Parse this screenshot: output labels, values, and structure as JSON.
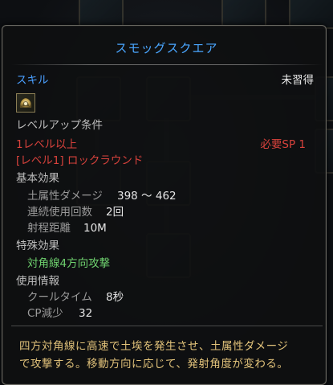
{
  "tooltip": {
    "title": "スモッグスクエア",
    "category_label": "スキル",
    "status": "未習得",
    "levelup_header": "レベルアップ条件",
    "req_level": "1レベル以上",
    "req_sp": "必要SP 1",
    "req_skill": "[レベル1] ロックラウンド",
    "basic_header": "基本効果",
    "basic": [
      {
        "label": "土属性ダメージ",
        "value": "398 ～ 462"
      },
      {
        "label": "連続使用回数",
        "value": "2回"
      },
      {
        "label": "射程距離",
        "value": "10M"
      }
    ],
    "special_header": "特殊効果",
    "special_effect": "対角線4方向攻撃",
    "usage_header": "使用情報",
    "usage": [
      {
        "label": "クールタイム",
        "value": "8秒"
      },
      {
        "label": "CP減少",
        "value": "32"
      }
    ],
    "description_line1": "四方対角線に高速で土埃を発生させ、土属性ダメージ",
    "description_line2": "で攻撃する。移動方向に応じて、発射角度が変わる。"
  },
  "colors": {
    "title_blue": "#4aa6ff",
    "requirement_red": "#d8423c",
    "special_green": "#6ed06e",
    "description_gold": "#e1c27a"
  },
  "icons": {
    "skill": "smog-square-skill-icon"
  }
}
